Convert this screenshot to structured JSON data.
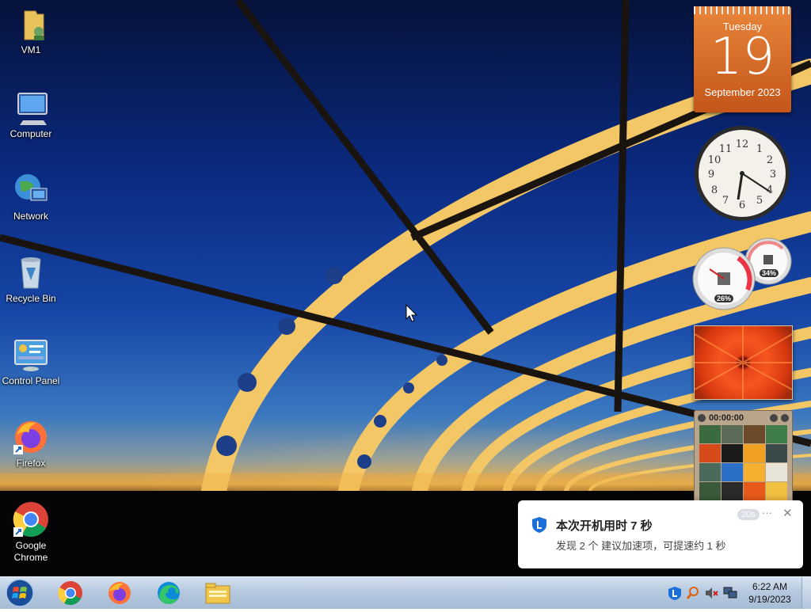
{
  "desktop": {
    "icons": [
      {
        "label": "VM1"
      },
      {
        "label": "Computer"
      },
      {
        "label": "Network"
      },
      {
        "label": "Recycle Bin"
      },
      {
        "label": "Control Panel"
      },
      {
        "label": "Firefox"
      },
      {
        "label": "Google Chrome"
      }
    ]
  },
  "gadgets": {
    "calendar": {
      "day": "Tuesday",
      "date": "19",
      "month": "September 2023"
    },
    "clock": {
      "numerals": [
        "12",
        "1",
        "2",
        "3",
        "4",
        "5",
        "6",
        "7",
        "8",
        "9",
        "10",
        "11"
      ]
    },
    "meter": {
      "cpu": "26%",
      "memory": "34%"
    },
    "puzzle": {
      "timer": "00:00:00"
    }
  },
  "notification": {
    "title": "本次开机用时 7 秒",
    "body": "发现 2 个 建议加速项，可提速约 1 秒",
    "countdown": "20s",
    "more_label": "···",
    "close_label": "✕"
  },
  "taskbar": {
    "apps": [
      "chrome",
      "firefox",
      "edge",
      "file-explorer"
    ],
    "time": "6:22 AM",
    "date": "9/19/2023"
  },
  "colors": {
    "calendar_orange": "#d96a2a",
    "taskbar": "#b5c9df",
    "toast_accent": "#1a6fd8"
  }
}
